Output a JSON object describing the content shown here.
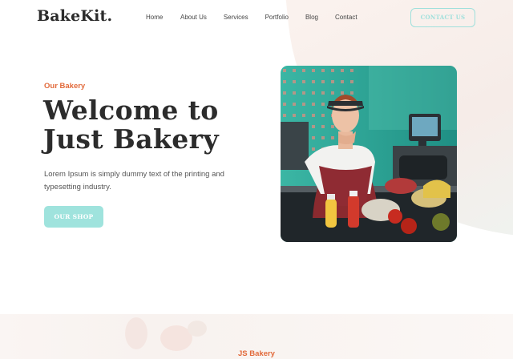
{
  "brand": {
    "logo": "BakeKit."
  },
  "nav": {
    "links": [
      "Home",
      "About Us",
      "Services",
      "Portfolio",
      "Blog",
      "Contact"
    ],
    "contact_button": "CONTACT US"
  },
  "hero": {
    "eyebrow": "Our Bakery",
    "title_line1": "Welcome to",
    "title_line2": "Just Bakery",
    "description": "Lorem Ipsum is simply dummy text of the printing and typesetting industry.",
    "button": "OUR SHOP"
  },
  "section": {
    "eyebrow": "JS Bakery"
  },
  "colors": {
    "accent_orange": "#e26a3b",
    "accent_teal": "#9fe3dd",
    "heading": "#2c2c2c"
  }
}
